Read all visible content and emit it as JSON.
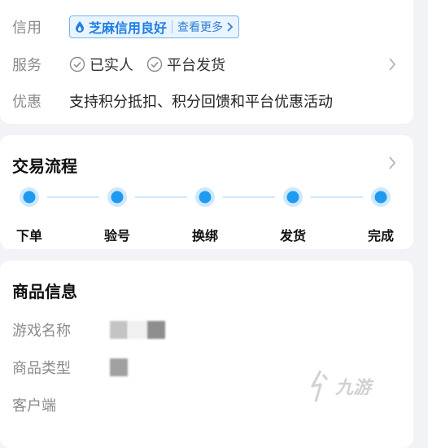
{
  "info": {
    "credit": {
      "label": "信用",
      "badge_text": "芝麻信用良好",
      "more_text": "查看更多"
    },
    "service": {
      "label": "服务",
      "items": [
        "已实人",
        "平台发货"
      ]
    },
    "promo": {
      "label": "优惠",
      "text": "支持积分抵扣、积分回馈和平台优惠活动"
    }
  },
  "flow": {
    "title": "交易流程",
    "steps": [
      "下单",
      "验号",
      "换绑",
      "发货",
      "完成"
    ]
  },
  "goods": {
    "title": "商品信息",
    "rows": [
      {
        "label": "游戏名称"
      },
      {
        "label": "商品类型"
      },
      {
        "label": "客户端"
      }
    ]
  },
  "watermark": {
    "text": "九游"
  },
  "colors": {
    "accent": "#1e9bf0",
    "accent_light": "#cfe8fb",
    "badge_text": "#1e7ee6",
    "label_gray": "#8a8a8f"
  }
}
